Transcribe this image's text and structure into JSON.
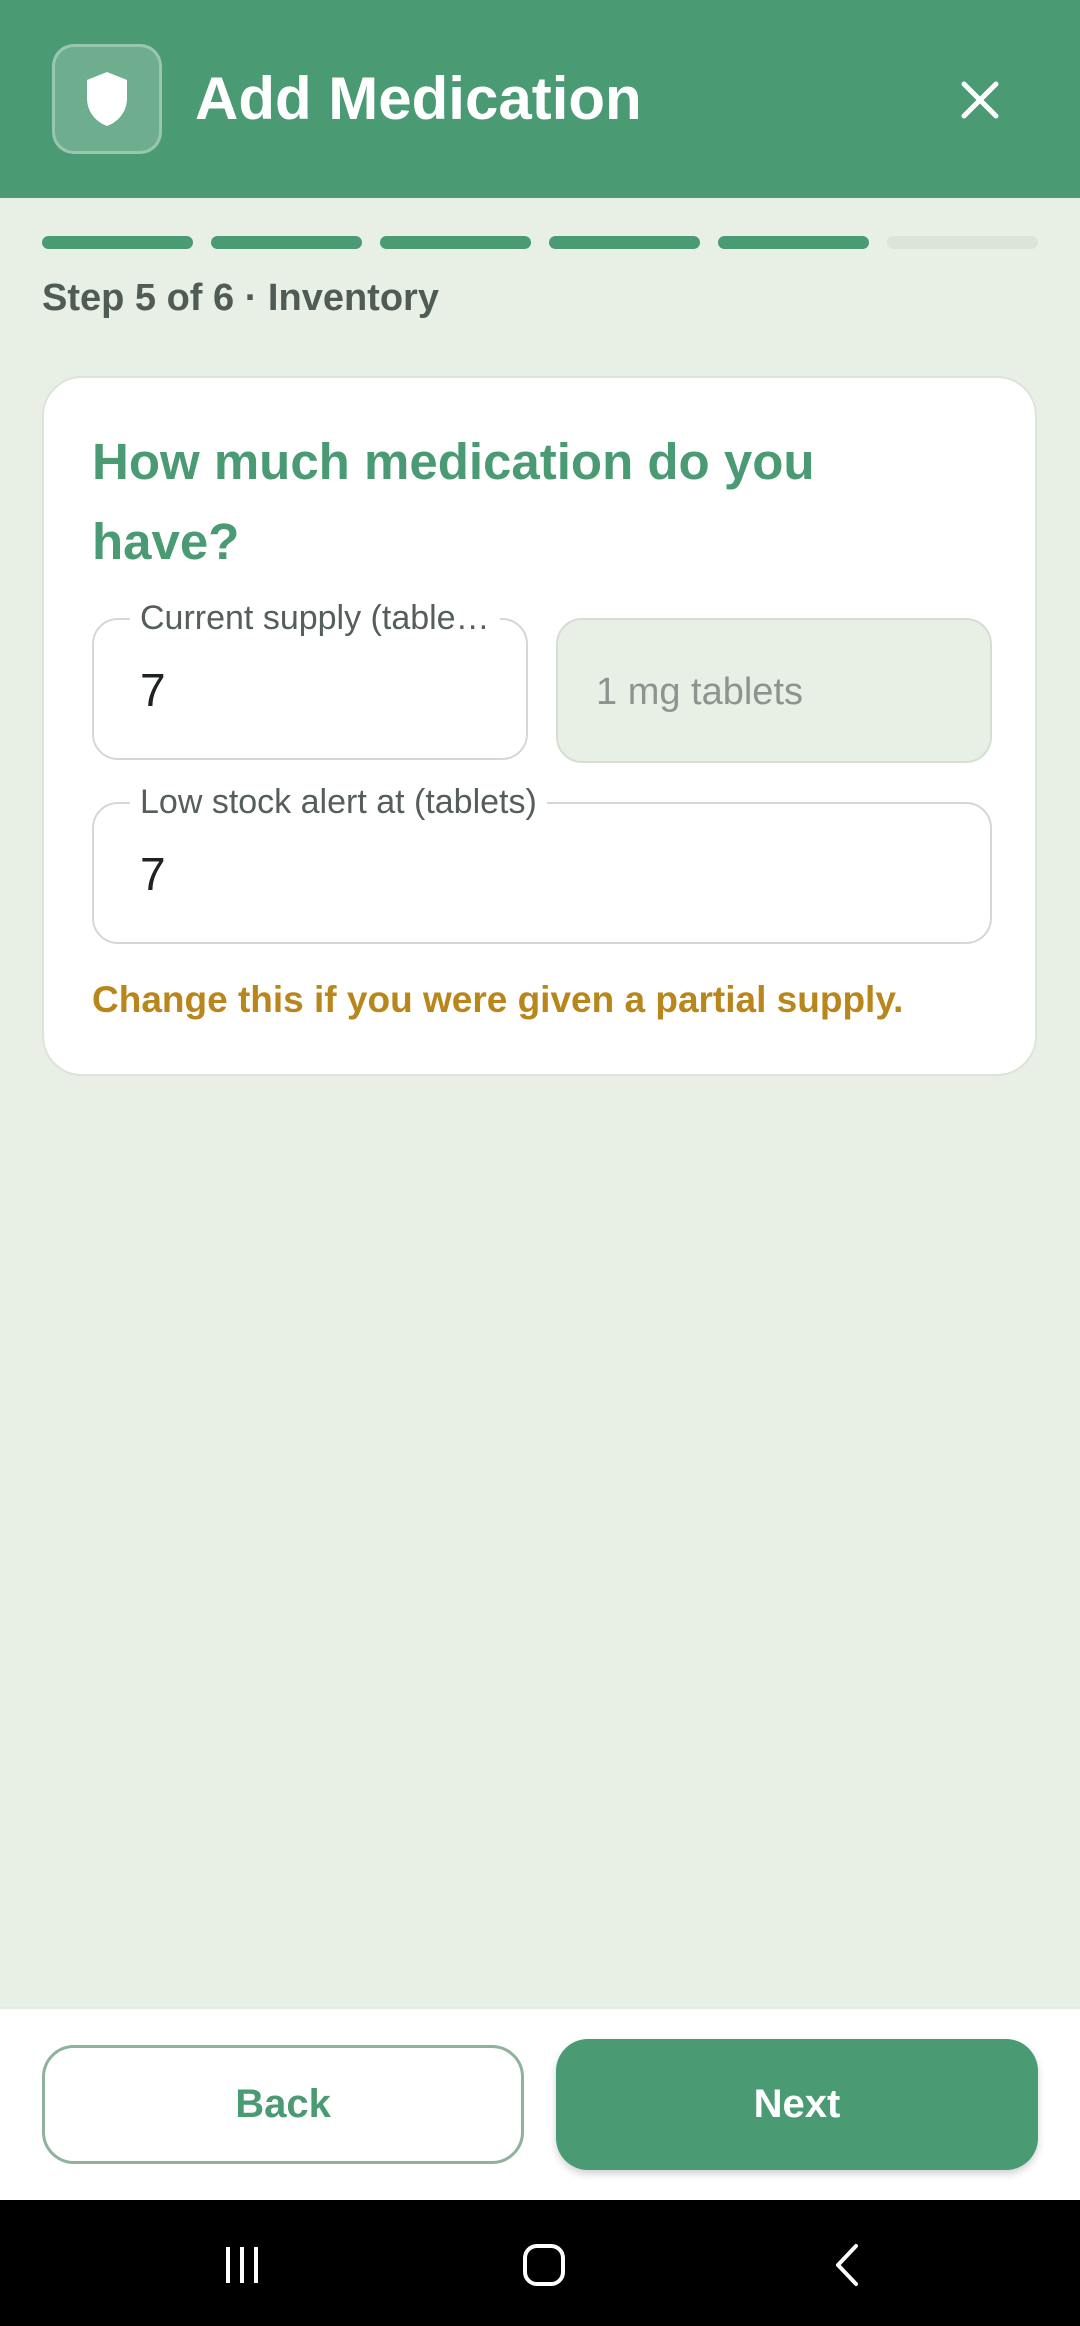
{
  "header": {
    "title": "Add Medication",
    "app_icon": "shield-icon",
    "close_icon": "close-icon",
    "background_color": "#4A9A74"
  },
  "progress": {
    "current_step": 5,
    "total_steps": 6,
    "step_label": "Step 5 of 6 · Inventory"
  },
  "card": {
    "title": "How much medication do you have?",
    "supply_field": {
      "label": "Current supply (tablets)",
      "value": "7"
    },
    "unit_display": "1 mg tablets",
    "alert_field": {
      "label": "Low stock alert at (tablets)",
      "value": "7"
    },
    "hint": "Change this if you were given a partial supply."
  },
  "footer": {
    "back_label": "Back",
    "next_label": "Next"
  },
  "system_nav": {
    "recents_icon": "recents-icon",
    "home_icon": "home-icon",
    "back_icon": "back-arrow-icon"
  },
  "colors": {
    "accent": "#4A9A74",
    "background": "#E8EFE4",
    "hint": "#B8861A"
  }
}
